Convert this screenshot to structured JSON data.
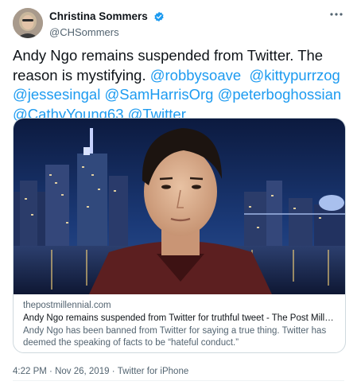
{
  "author": {
    "display_name": "Christina Sommers",
    "handle": "@CHSommers",
    "verified": true
  },
  "more_icon": "more-horizontal-icon",
  "tweet": {
    "text_prefix": "Andy Ngo remains suspended from Twitter. The reason is mystifying. ",
    "mentions": [
      "@robbysoave",
      "@kittypurrzog",
      "@jessesingal",
      "@SamHarrisOrg",
      "@peterboghossian",
      "@CathyYoung63",
      "@Twitter"
    ]
  },
  "card": {
    "domain": "thepostmillennial.com",
    "title": "Andy Ngo remains suspended from Twitter for truthful tweet - The Post Millenn...",
    "description": "Andy Ngo has been banned from Twitter for saying a true thing. Twitter has deemed the speaking of facts to be “hateful conduct.”"
  },
  "meta": {
    "time": "4:22 PM",
    "separator": "·",
    "date": "Nov 26, 2019",
    "source": "Twitter for iPhone"
  },
  "colors": {
    "link": "#1d9bf0",
    "secondary_text": "#536471",
    "verified_badge": "#1d9bf0"
  }
}
